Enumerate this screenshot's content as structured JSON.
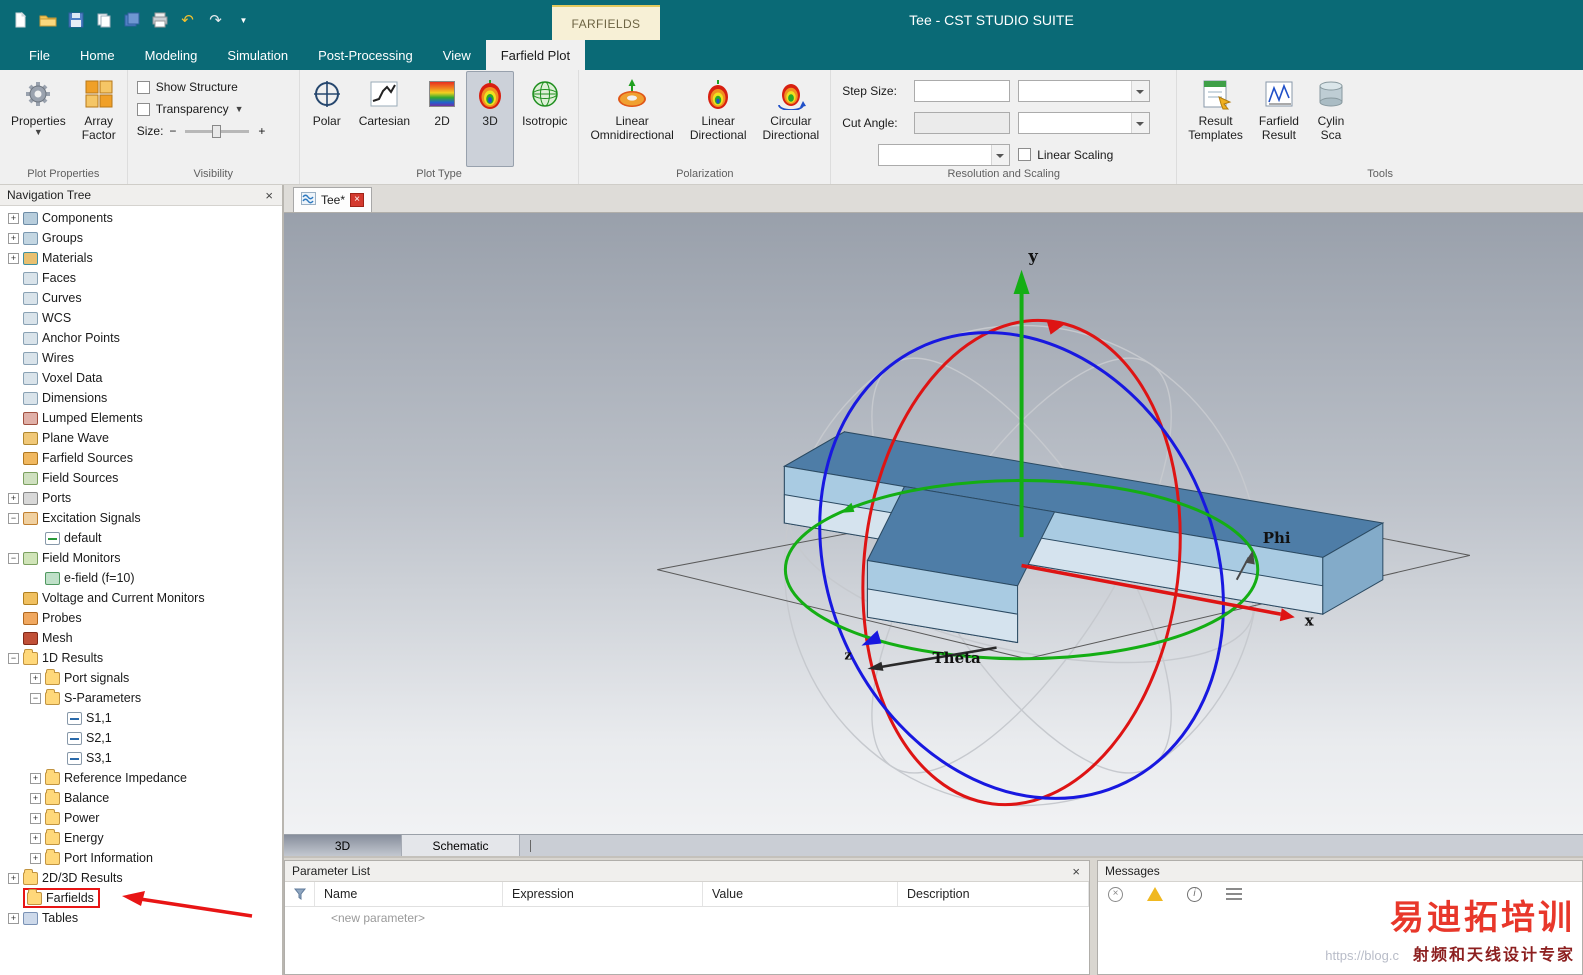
{
  "window": {
    "title": "Tee - CST STUDIO SUITE",
    "contextual_tab": "FARFIELDS",
    "quick_access_icons": [
      "new-document",
      "open-folder",
      "save",
      "copy",
      "save-all",
      "print",
      "undo",
      "redo",
      "customize"
    ]
  },
  "menubar": {
    "tabs": [
      {
        "label": "File",
        "active": false
      },
      {
        "label": "Home",
        "active": false
      },
      {
        "label": "Modeling",
        "active": false
      },
      {
        "label": "Simulation",
        "active": false
      },
      {
        "label": "Post-Processing",
        "active": false
      },
      {
        "label": "View",
        "active": false
      },
      {
        "label": "Farfield Plot",
        "active": true
      }
    ]
  },
  "ribbon": {
    "plot_properties": {
      "label": "Plot Properties",
      "properties": "Properties",
      "array_factor": "Array\nFactor"
    },
    "visibility": {
      "label": "Visibility",
      "show_structure": "Show Structure",
      "show_structure_checked": false,
      "transparency": "Transparency",
      "transparency_checked": false,
      "size": "Size:",
      "size_minus": "−",
      "size_plus": "+"
    },
    "plot_type": {
      "label": "Plot Type",
      "polar": "Polar",
      "cartesian": "Cartesian",
      "two_d": "2D",
      "three_d": "3D",
      "isotropic": "Isotropic",
      "selected": "3D"
    },
    "polarization": {
      "label": "Polarization",
      "linear_omni": "Linear\nOmnidirectional",
      "linear_dir": "Linear\nDirectional",
      "circular_dir": "Circular\nDirectional"
    },
    "resolution_scaling": {
      "label": "Resolution and Scaling",
      "step_size": "Step Size:",
      "step_size_value": "",
      "cut_angle": "Cut Angle:",
      "cut_angle_value": "",
      "linear_scaling": "Linear Scaling",
      "linear_scaling_checked": false
    },
    "tools": {
      "label": "Tools",
      "result_templates": "Result\nTemplates",
      "farfield_result": "Farfield\nResult",
      "cylinder_scan": "Cylin\nSca"
    }
  },
  "navigation_tree": {
    "title": "Navigation Tree",
    "items": [
      {
        "label": "Components",
        "indent": 0,
        "expander": "plus",
        "icon": "components"
      },
      {
        "label": "Groups",
        "indent": 0,
        "expander": "plus",
        "icon": "groups"
      },
      {
        "label": "Materials",
        "indent": 0,
        "expander": "plus",
        "icon": "materials"
      },
      {
        "label": "Faces",
        "indent": 0,
        "expander": "none",
        "icon": "faces"
      },
      {
        "label": "Curves",
        "indent": 0,
        "expander": "none",
        "icon": "curves"
      },
      {
        "label": "WCS",
        "indent": 0,
        "expander": "none",
        "icon": "wcs"
      },
      {
        "label": "Anchor Points",
        "indent": 0,
        "expander": "none",
        "icon": "anchor"
      },
      {
        "label": "Wires",
        "indent": 0,
        "expander": "none",
        "icon": "wires"
      },
      {
        "label": "Voxel Data",
        "indent": 0,
        "expander": "none",
        "icon": "voxel"
      },
      {
        "label": "Dimensions",
        "indent": 0,
        "expander": "none",
        "icon": "dimensions"
      },
      {
        "label": "Lumped Elements",
        "indent": 0,
        "expander": "none",
        "icon": "lumped"
      },
      {
        "label": "Plane Wave",
        "indent": 0,
        "expander": "none",
        "icon": "planewave"
      },
      {
        "label": "Farfield Sources",
        "indent": 0,
        "expander": "none",
        "icon": "ffsources"
      },
      {
        "label": "Field Sources",
        "indent": 0,
        "expander": "none",
        "icon": "fieldsources"
      },
      {
        "label": "Ports",
        "indent": 0,
        "expander": "plus",
        "icon": "ports"
      },
      {
        "label": "Excitation Signals",
        "indent": 0,
        "expander": "minus",
        "icon": "excitation"
      },
      {
        "label": "default",
        "indent": 1,
        "expander": "none",
        "icon": "signal"
      },
      {
        "label": "Field Monitors",
        "indent": 0,
        "expander": "minus",
        "icon": "monitors"
      },
      {
        "label": "e-field (f=10)",
        "indent": 1,
        "expander": "none",
        "icon": "efield"
      },
      {
        "label": "Voltage and Current Monitors",
        "indent": 0,
        "expander": "none",
        "icon": "voltage"
      },
      {
        "label": "Probes",
        "indent": 0,
        "expander": "none",
        "icon": "probes"
      },
      {
        "label": "Mesh",
        "indent": 0,
        "expander": "none",
        "icon": "mesh"
      },
      {
        "label": "1D Results",
        "indent": 0,
        "expander": "minus",
        "icon": "results1d"
      },
      {
        "label": "Port signals",
        "indent": 1,
        "expander": "plus",
        "icon": "folder"
      },
      {
        "label": "S-Parameters",
        "indent": 1,
        "expander": "minus",
        "icon": "folder"
      },
      {
        "label": "S1,1",
        "indent": 2,
        "expander": "none",
        "icon": "sparam"
      },
      {
        "label": "S2,1",
        "indent": 2,
        "expander": "none",
        "icon": "sparam"
      },
      {
        "label": "S3,1",
        "indent": 2,
        "expander": "none",
        "icon": "sparam"
      },
      {
        "label": "Reference Impedance",
        "indent": 1,
        "expander": "plus",
        "icon": "folder"
      },
      {
        "label": "Balance",
        "indent": 1,
        "expander": "plus",
        "icon": "folder"
      },
      {
        "label": "Power",
        "indent": 1,
        "expander": "plus",
        "icon": "folder"
      },
      {
        "label": "Energy",
        "indent": 1,
        "expander": "plus",
        "icon": "folder"
      },
      {
        "label": "Port Information",
        "indent": 1,
        "expander": "plus",
        "icon": "folder"
      },
      {
        "label": "2D/3D Results",
        "indent": 0,
        "expander": "plus",
        "icon": "results2d"
      },
      {
        "label": "Farfields",
        "indent": 0,
        "expander": "none",
        "icon": "farfields",
        "highlighted": true
      },
      {
        "label": "Tables",
        "indent": 0,
        "expander": "plus",
        "icon": "tables"
      }
    ]
  },
  "document": {
    "tab_label": "Tee*",
    "view_tabs": [
      "3D",
      "Schematic"
    ],
    "active_view_tab": "3D"
  },
  "scene": {
    "axis_y": "y",
    "axis_x": "x",
    "axis_z": "z",
    "phi": "Phi",
    "theta": "Theta"
  },
  "parameter_list": {
    "title": "Parameter List",
    "columns": [
      "Name",
      "Expression",
      "Value",
      "Description"
    ],
    "new_row": "<new parameter>"
  },
  "messages": {
    "title": "Messages"
  },
  "watermark": {
    "line1": "易迪拓培训",
    "line2": "射频和天线设计专家",
    "url": "https://blog.c"
  }
}
